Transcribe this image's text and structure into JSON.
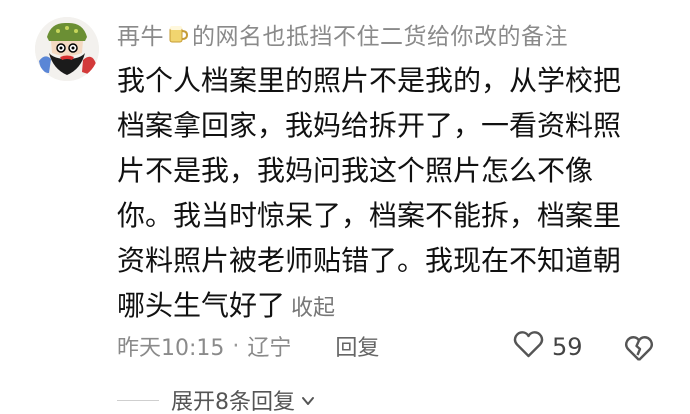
{
  "comment": {
    "username_prefix": "再牛",
    "username_suffix": "的网名也抵挡不住二货给你改的备注",
    "name_emoji_icon": "beer-mug-icon",
    "body_lines": [
      "我个人档案里的照片不是我的，从学校把",
      "档案拿回家，我妈给拆开了，一看资料照",
      "片不是我，我妈问我这个照片怎么不像",
      "你。我当时惊呆了，档案不能拆，档案里",
      "资料照片被老师贴错了。我现在不知道朝",
      "哪头生气好了"
    ],
    "collapse_label": "收起",
    "timestamp": "昨天10:15",
    "separator": "·",
    "location": "辽宁",
    "reply_label": "回复",
    "like_count": "59",
    "like_icon": "heart-outline-icon",
    "dislike_icon": "broken-heart-icon",
    "expand_replies_label": "展开8条回复"
  }
}
